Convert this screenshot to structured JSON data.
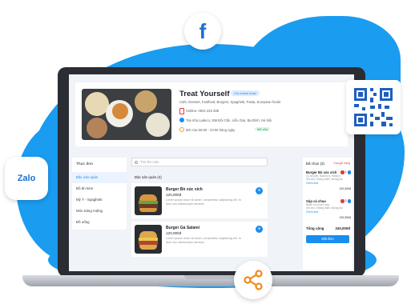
{
  "colors": {
    "accent": "#1a8df0",
    "danger": "#e03c3c",
    "brand_blob": "#1a9cf0"
  },
  "restaurant": {
    "name": "Treat Yourself",
    "badge": "Chi nhánh khác",
    "cuisines": "Cafe, Dessert, Fastfood, Burgers, Spaghetti, Pasta, European foods",
    "hotline": "Hotline: 0944 233 288",
    "address": "Toà nhà Ladeco, 266 Đội Cấn, Liễu Giai, Ba Đình, Hà Nội",
    "hours": "Mở cửa 08:00 - 22:00 hàng ngày",
    "status": "Mở cửa"
  },
  "menu": {
    "header": "Thực đơn",
    "categories": [
      {
        "label": "Đặc sản quán",
        "active": true
      },
      {
        "label": "Đồ ăn kèm",
        "active": false
      },
      {
        "label": "Mỳ Ý - Spaghetti",
        "active": false
      },
      {
        "label": "Món tráng miệng",
        "active": false
      },
      {
        "label": "Đồ uống",
        "active": false
      }
    ]
  },
  "search": {
    "placeholder": "Tìm tên món"
  },
  "section": {
    "title": "Đặc sản quán (4)"
  },
  "items": [
    {
      "name": "Burger Bò xúc xích",
      "price": "120,000đ",
      "desc": "Lorem ipsum dolor sit amet, consectetur adipiscing elit. In duis non ullamcorper aenean."
    },
    {
      "name": "Burger Gà Salami",
      "price": "120,000đ",
      "desc": "Lorem ipsum dolor sit amet, consectetur adipiscing elit. In duis non ullamcorper aenean."
    }
  ],
  "order": {
    "header": "Đã chọn (3)",
    "clear": "Xóa giỏ hàng",
    "lines": [
      {
        "name": "Burger Bò xúc xích",
        "sub1": "Có chuyện, Bacon(x), Hành(x)",
        "sub2": "Ghi chú: Không hành, không rau",
        "edit": "Chỉnh sửa",
        "qty": "1",
        "amount": "120,000đ"
      },
      {
        "name": "Súp cà chua",
        "sub1": "Nhiều cà chua ít súp",
        "sub2": "Ghi chú: Không hành, không rau",
        "edit": "Chỉnh sửa",
        "qty": "2",
        "amount": "120,000đ"
      }
    ],
    "total_label": "Tổng cộng",
    "total_value": "240,000đ",
    "submit": "Đặt đơn"
  },
  "social": {
    "facebook": "f",
    "zalo": "Zalo",
    "share": "share-icon",
    "qr": "qr-code-icon"
  }
}
